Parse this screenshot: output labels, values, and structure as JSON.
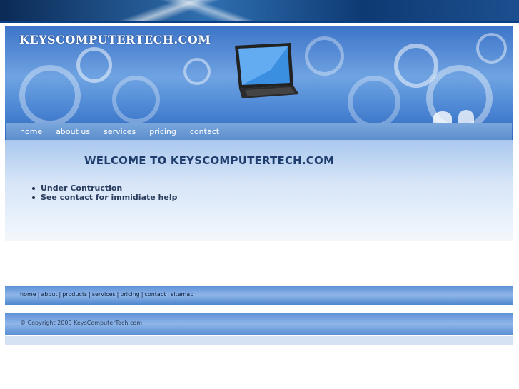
{
  "header": {
    "site_title": "KEYSCOMPUTERTECH.COM"
  },
  "nav": {
    "items": [
      {
        "label": "home"
      },
      {
        "label": "about us"
      },
      {
        "label": "services"
      },
      {
        "label": "pricing"
      },
      {
        "label": "contact"
      }
    ]
  },
  "main": {
    "welcome": "WELCOME TO KEYSCOMPUTERTECH.COM",
    "bullets": [
      "Under Contruction",
      "See contact for immidiate help"
    ]
  },
  "footer": {
    "links": [
      "home",
      "about",
      "products",
      "services",
      "pricing",
      "contact",
      "sitemap"
    ],
    "separator": "|",
    "copyright": "© Copyright 2009 KeysComputerTech.com"
  },
  "colors": {
    "banner": "#4a85d3",
    "heading": "#1f3d6c"
  }
}
